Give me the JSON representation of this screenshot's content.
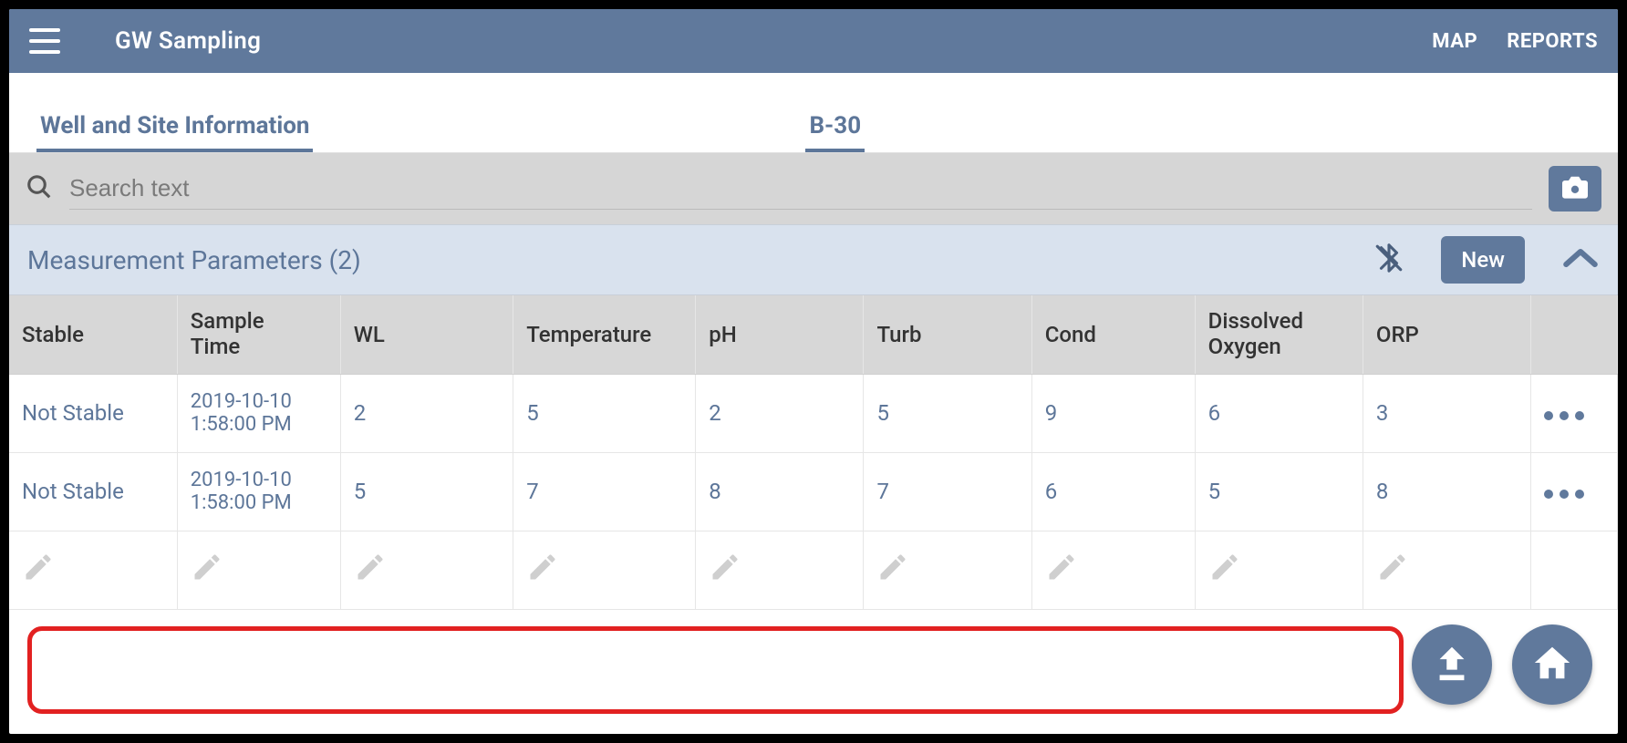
{
  "appbar": {
    "title": "GW Sampling",
    "nav": {
      "map": "MAP",
      "reports": "REPORTS"
    }
  },
  "tabs": {
    "well_info": "Well and Site Information",
    "well_id": "B-30"
  },
  "search": {
    "placeholder": "Search text",
    "value": ""
  },
  "section": {
    "title": "Measurement Parameters (2)",
    "new_label": "New"
  },
  "columns": {
    "stable": "Stable",
    "sample_time_l1": "Sample",
    "sample_time_l2": "Time",
    "wl": "WL",
    "temperature": "Temperature",
    "ph": "pH",
    "turb": "Turb",
    "cond": "Cond",
    "do_l1": "Dissolved",
    "do_l2": "Oxygen",
    "orp": "ORP"
  },
  "rows": [
    {
      "stable": "Not Stable",
      "time_l1": "2019-10-10",
      "time_l2": "1:58:00 PM",
      "wl": "2",
      "temperature": "5",
      "ph": "2",
      "turb": "5",
      "cond": "9",
      "do": "6",
      "orp": "3"
    },
    {
      "stable": "Not Stable",
      "time_l1": "2019-10-10",
      "time_l2": "1:58:00 PM",
      "wl": "5",
      "temperature": "7",
      "ph": "8",
      "turb": "7",
      "cond": "6",
      "do": "5",
      "orp": "8"
    }
  ],
  "icons": {
    "hamburger": "menu-icon",
    "search": "search-icon",
    "camera": "camera-icon",
    "bluetooth": "bluetooth-off-icon",
    "chevron": "chevron-up-icon",
    "dots": "more-icon",
    "pencil": "pencil-icon",
    "upload": "upload-icon",
    "home": "home-icon"
  },
  "colors": {
    "brand": "#60799c",
    "accent_text": "#5d7699"
  }
}
